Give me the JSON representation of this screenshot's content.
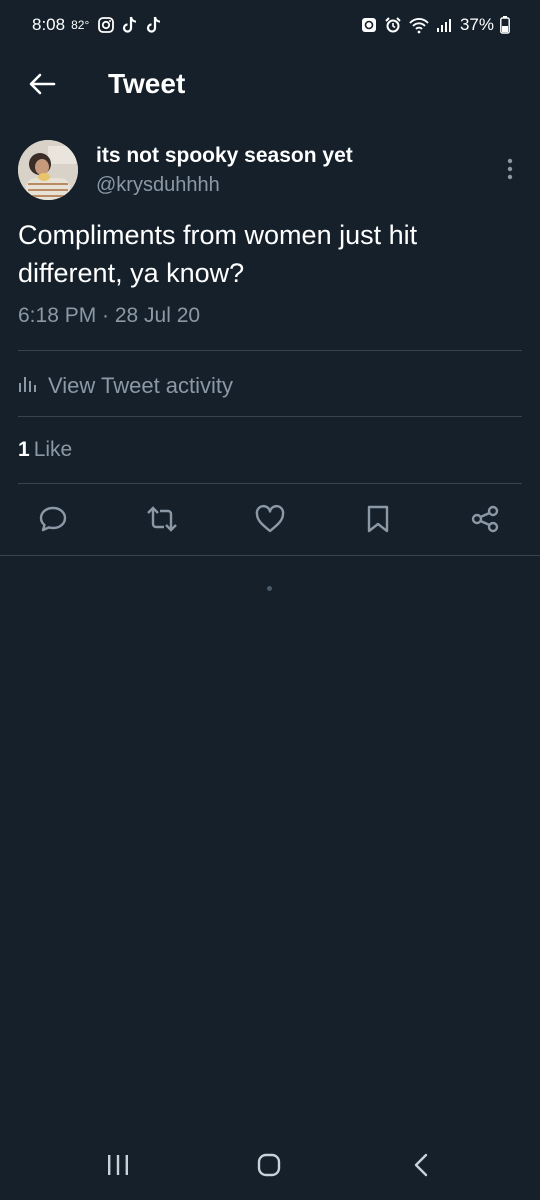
{
  "status_bar": {
    "time": "8:08",
    "temperature": "82°",
    "battery": "37%",
    "left_icons": [
      "instagram-icon",
      "tiktok-icon",
      "tiktok-icon"
    ],
    "right_icons": [
      "sync-icon",
      "alarm-icon",
      "wifi-icon",
      "signal-icon",
      "battery-icon"
    ]
  },
  "header": {
    "title": "Tweet"
  },
  "tweet": {
    "author_name": "its not spooky season yet",
    "author_handle": "@krysduhhhh",
    "text": "Compliments from women just hit different, ya know?",
    "timestamp": "6:18 PM · 28 Jul 20",
    "activity_label": "View Tweet activity",
    "like_count": "1",
    "like_label": "Like"
  },
  "actions": [
    "reply-icon",
    "retweet-icon",
    "like-icon",
    "bookmark-icon",
    "share-icon"
  ],
  "nav": [
    "recent-apps-icon",
    "home-icon",
    "back-icon"
  ],
  "colors": {
    "background": "#15202b",
    "divider": "#38444d",
    "secondary_text": "#8b98a5",
    "icon": "#8b98a5"
  }
}
